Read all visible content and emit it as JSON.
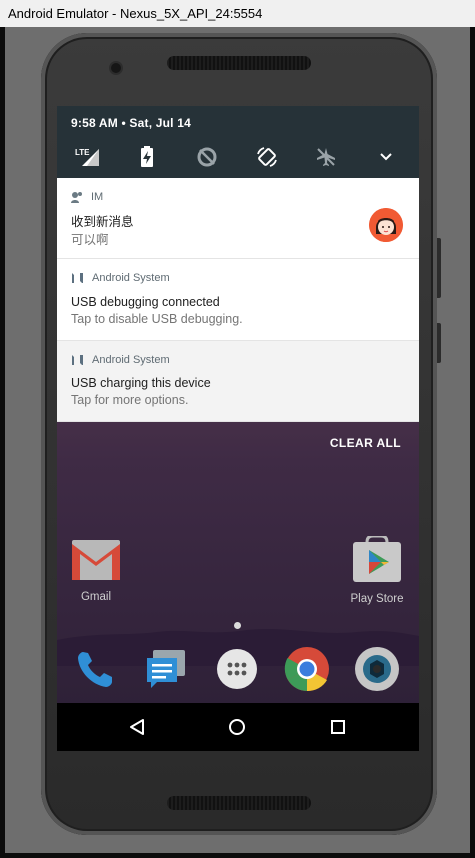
{
  "window": {
    "title": "Android Emulator - Nexus_5X_API_24:5554"
  },
  "status": {
    "time_date": "9:58 AM • Sat, Jul 14"
  },
  "quick_settings": {
    "icons": [
      "lte-signal-icon",
      "battery-charging-icon",
      "data-saver-off-icon",
      "auto-rotate-icon",
      "airplane-mode-icon",
      "expand-chevron-icon"
    ],
    "lte_label": "LTE"
  },
  "notifications": [
    {
      "app": "IM",
      "title": "收到新消息",
      "text": "可以啊",
      "has_avatar": true
    },
    {
      "app": "Android System",
      "title": "USB debugging connected",
      "text": "Tap to disable USB debugging."
    },
    {
      "app": "Android System",
      "title": "USB charging this device",
      "text": "Tap for more options."
    }
  ],
  "clear_all": "CLEAR ALL",
  "home": {
    "apps": [
      {
        "label": "Gmail",
        "icon": "gmail-icon"
      },
      {
        "label": "Play Store",
        "icon": "play-store-icon"
      }
    ],
    "dock": [
      "phone-icon",
      "messages-icon",
      "app-drawer-icon",
      "chrome-icon",
      "camera-icon"
    ]
  },
  "navigation": [
    "back-icon",
    "home-icon",
    "recents-icon"
  ],
  "colors": {
    "qs_background": "#263238",
    "avatar_background": "#f15a33",
    "notification_title": "#212121",
    "notification_text": "#757575"
  }
}
